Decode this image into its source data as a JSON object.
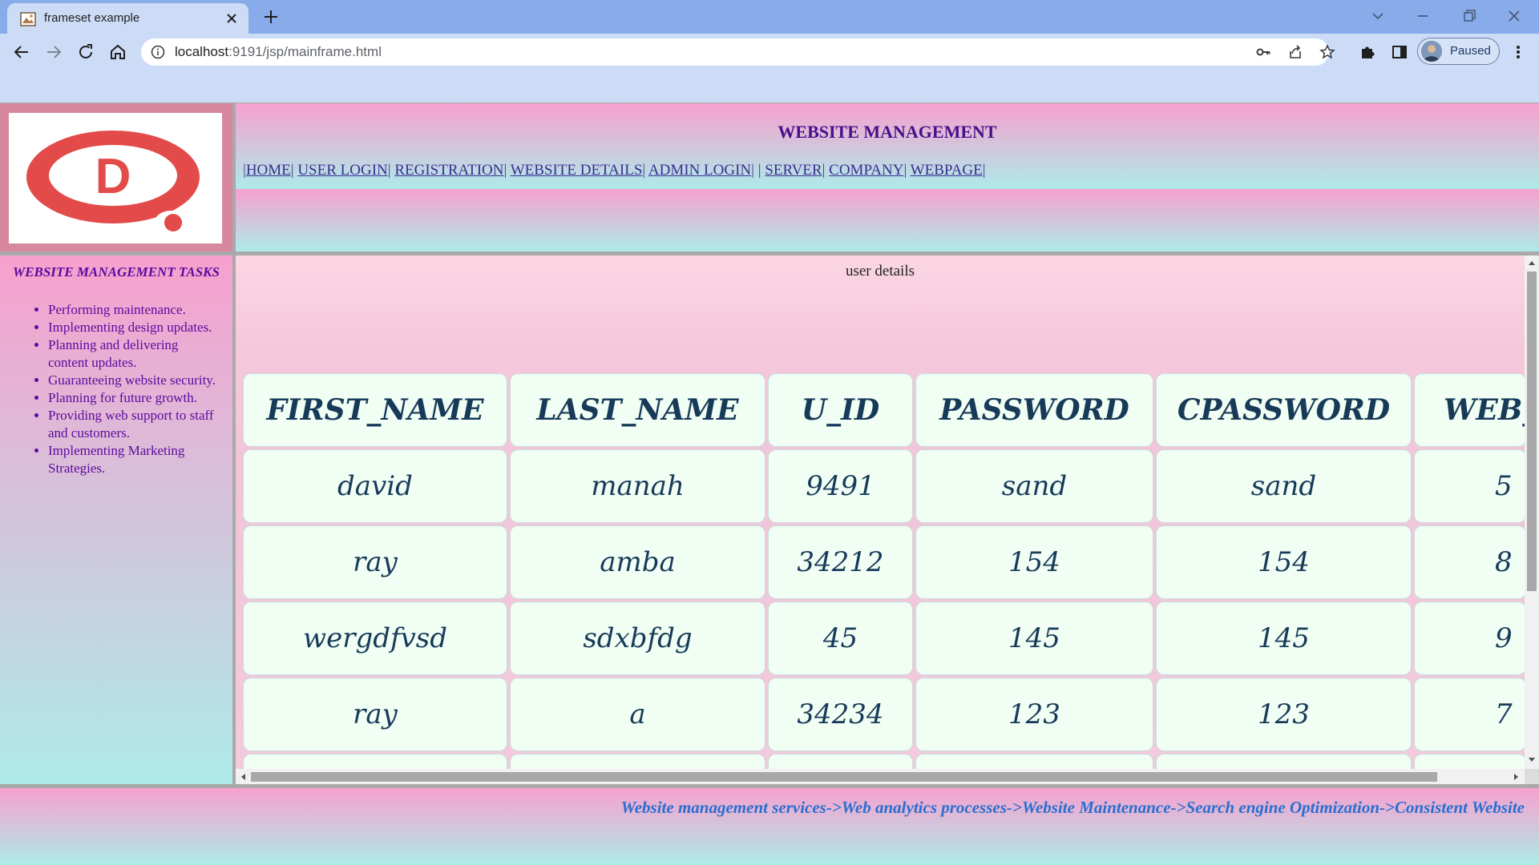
{
  "browser": {
    "tab_title": "frameset example",
    "url_host": "localhost",
    "url_rest": ":9191/jsp/mainframe.html",
    "profile_label": "Paused"
  },
  "header": {
    "title": "WEBSITE MANAGEMENT",
    "nav": [
      {
        "label": "HOME"
      },
      {
        "label": "USER LOGIN"
      },
      {
        "label": "REGISTRATION"
      },
      {
        "label": "WEBSITE DETAILS"
      },
      {
        "label": "ADMIN LOGIN"
      },
      {
        "label": "SERVER"
      },
      {
        "label": "COMPANY"
      },
      {
        "label": "WEBPAGE"
      }
    ],
    "logo_letter": "D"
  },
  "sidebar": {
    "title": "WEBSITE MANAGEMENT TASKS",
    "items": [
      "Performing maintenance.",
      "Implementing design updates.",
      "Planning and delivering content updates.",
      "Guaranteeing website security.",
      "Planning for future growth.",
      "Providing web support to staff and customers.",
      "Implementing Marketing Strategies."
    ]
  },
  "main": {
    "caption": "user details",
    "table": {
      "headers": [
        "FIRST_NAME",
        "LAST_NAME",
        "U_ID",
        "PASSWORD",
        "CPASSWORD",
        "WEB_"
      ],
      "rows": [
        [
          "david",
          "manah",
          "9491",
          "sand",
          "sand",
          "5"
        ],
        [
          "ray",
          "amba",
          "34212",
          "154",
          "154",
          "8"
        ],
        [
          "wergdfvsd",
          "sdxbfdg",
          "45",
          "145",
          "145",
          "9"
        ],
        [
          "ray",
          "a",
          "34234",
          "123",
          "123",
          "7"
        ]
      ]
    }
  },
  "footer": {
    "marquee": "Website management services->Web analytics processes->Website Maintenance->Search engine Optimization->Consistent Website"
  },
  "colors": {
    "pink": "#f7a0ce",
    "aqua": "#aeeaea",
    "heading_purple": "#4a0e8a",
    "table_cell_bg": "#f0fef4",
    "table_text": "#183a59",
    "marquee_blue": "#2b6ed0"
  }
}
